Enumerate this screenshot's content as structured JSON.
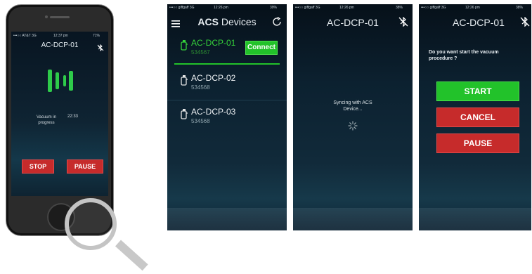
{
  "phone": {
    "carrier": "•••○○ AT&T  3G",
    "time": "12:37 pm",
    "battery": "71%",
    "device_title": "AC-DCP-01",
    "status_label": "Vacuum in progress",
    "status_value": "22:33",
    "stop_label": "STOP",
    "pause_label": "PAUSE"
  },
  "screen1": {
    "carrier": "•••○○ giffgaff  3G",
    "time": "12:26 pm",
    "battery": "39%",
    "title_bold": "ACS",
    "title_rest": "Devices",
    "devices": [
      {
        "name": "AC-DCP-01",
        "id": "534567",
        "active": true
      },
      {
        "name": "AC-DCP-02",
        "id": "534568",
        "active": false
      },
      {
        "name": "AC-DCP-03",
        "id": "534568",
        "active": false
      }
    ],
    "connect_label": "Connect"
  },
  "screen2": {
    "carrier": "•••○○ giffgaff  3G",
    "time": "12:26 pm",
    "battery": "38%",
    "title": "AC-DCP-01",
    "sync_text_1": "Syncing with ACS",
    "sync_text_2": "Device..."
  },
  "screen3": {
    "carrier": "•••○○ giffgaff  3G",
    "time": "12:26 pm",
    "battery": "38%",
    "title": "AC-DCP-01",
    "question": "Do you want start the vacuum procedure ?",
    "start_label": "START",
    "cancel_label": "CANCEL",
    "pause_label": "PAUSE"
  },
  "colors": {
    "green": "#22c22a",
    "red": "#c62b2b",
    "bg_dark": "#0c2130"
  }
}
